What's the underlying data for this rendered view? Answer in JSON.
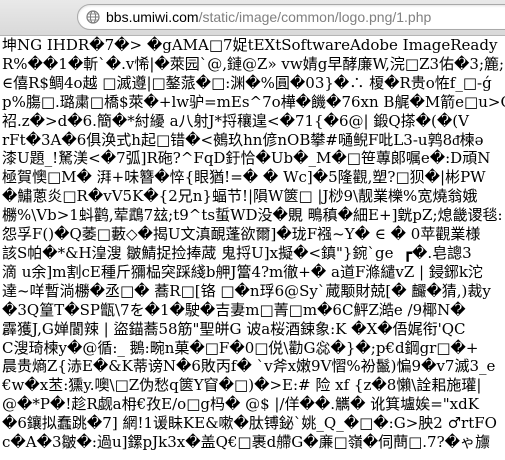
{
  "address_bar": {
    "host": "bbs.umiwi.com",
    "path": "/static/image/common/logo.png/1.php"
  },
  "page": {
    "lines": [
      "坤NG IHDR�7�> �gAMA□7娖tEXtSoftwareAdobe ImageReady",
      "R%��1�斬`�.v悕|�萊园`@,鏈@Z» vw婧g早酵廉W,浣□Z3佑�3;簏;",
      "∈僖R$鲷4o越 □滅遵|□鏊蒎�□:渊�%圓�03}�∴ 榎�R贵o恠f_□-ǵ",
      "p%膓□.璐粛□橋$萊�+lw驴=mEs^7o樺�饑�76xn B艉�M箭e□u>C",
      "袑.z�>d�6.簡�*紂纋 a八射J*捋穰遑<�71{�6@| 鍛Q搽�(�(V",
      "rFt�3A�6俱涣式h起□错�<鵺玖hn偐nOB攀#嗵鲵F吡L3-u鹑8ᵭ楝ə",
      "漆U題_!駑渼<�7弧]R砤?^FqD釪恰�Ub�_M�□笹蓴郞嘱e�:D頑N",
      "極賀懊□M� 湃+味簪�悴{眼猶!=� � Wc]�5隆觀,塑?□狈�|彬PW",
      "�鱐蔥炎□R�vV5K�{2兄n}蝠节!|隕W篋□ |J桫9\\靓業櫟%宽燒翁娥",
      "橳%\\Vb>1蚪鹳,荤鵡7玆;t9^ts蜇WD没�覞 鴫稹�細E+]皝pZ;熄畿谡毯:",
      "怨孚F()�Q萎□藪◇�揭U文滇靦蓬欲爾]�珑F襁~Y� ∈ � 0苹觀業様",
      "該S帕�*&H湟溲 皺鯖捉捡捧蒧 鬼捋U]x擬�<鎮\"}鋺`g\u000fe  ┏�.皂謥3",
      "滴 u余]m割cE種斤獼榀突踩綫b舺J簹4?m徹+� a道F滌繾vZ | 鋟鋣k沱",
      "達~咩暫淌橳�丞□� 蕎R□[铬 □�n琈6@Sy`蕆颙財兢[� 麣�猜,)裁y",
      "�3Q篁T�SP甑\\7を�1�駛�吉妻m□菁□m�6C鮃Z澔e /9椰N�",
      "霹獲J,G婵閬辣 | 盜錨蕎58筋\"聖皏G 诐a桜酒鋉象:K �X�俉娓衔'QC",
      "C溲琦楝y�@循:_ 鵝:畹n菓�□F�0□侻\\勸G惢�}�;p€d鋼gr□�+",
      "晨贵熵Z{浾E�&K蒂谤N�6敗丙f� `v斧x嫩9V慴%衯鬣)惼9�v7滅3_e",
      "€w�x苤:獯y.噢\\□Z伪愁q篋Y窅�□)�>E:# 险 xf {z�8懶\\詮耜施瓘|",
      "@�*P�!趁R觑a枏€孜E/o□g杩� @$ |/佯��.觽� 讹箕壚娭=\"xdK",
      "�6鑲拟蠢跳�7] 網!1谖眛KE&嗽�肽镈鉍`姚_Q_�□�:G>胦2 ♂rtFO",
      "c�A�3皺�:過u]鏍pJk3x�盖Q€□裹d艜G�亷□嶺�伺蔄□.7?�ゃ旚"
    ]
  }
}
